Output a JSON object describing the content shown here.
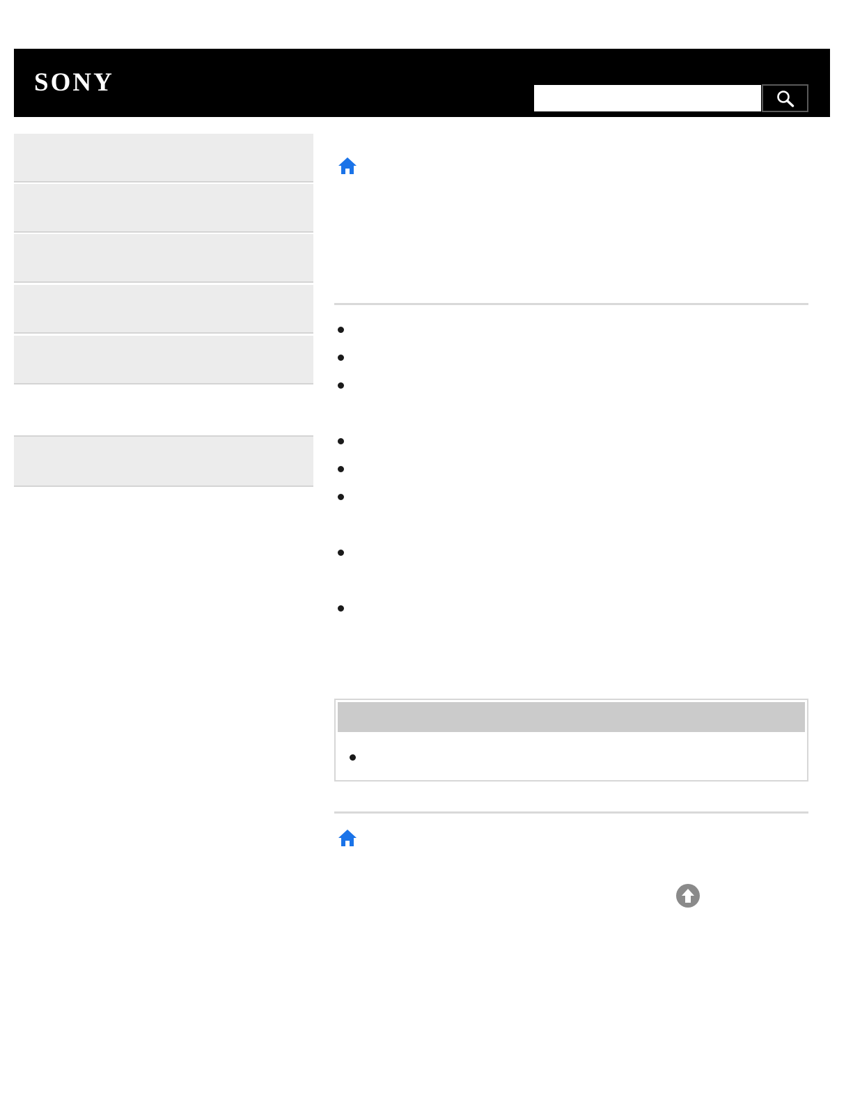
{
  "header": {
    "logo_text": "SONY",
    "search": {
      "value": "",
      "placeholder": "",
      "button_icon": "search-icon"
    }
  },
  "sidebar": {
    "items": [
      {
        "label": ""
      },
      {
        "label": ""
      },
      {
        "label": ""
      },
      {
        "label": ""
      },
      {
        "label": ""
      },
      {
        "label": ""
      }
    ]
  },
  "main": {
    "home_icon": "home-icon",
    "title": "",
    "bullets": [
      {
        "text": ""
      },
      {
        "text": ""
      },
      {
        "text": ""
      },
      {
        "text": ""
      },
      {
        "text": ""
      },
      {
        "text": ""
      },
      {
        "text": ""
      },
      {
        "text": ""
      }
    ],
    "related": {
      "header": "",
      "items": [
        {
          "text": ""
        }
      ]
    },
    "back_to_top_icon": "arrow-up-circle-icon"
  },
  "colors": {
    "header_bg": "#000000",
    "sidebar_bg": "#ececec",
    "sidebar_border": "#d4d4d4",
    "accent_blue": "#1a73e8",
    "related_header_bg": "#cbcbcb",
    "top_button": "#8a8a8a"
  }
}
